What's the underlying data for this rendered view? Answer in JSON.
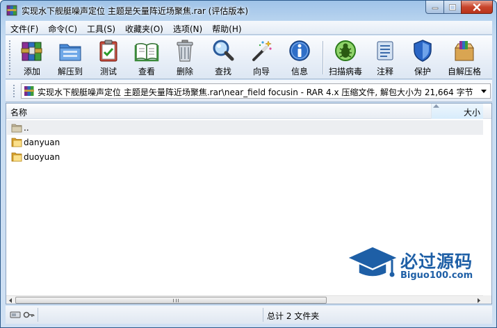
{
  "window": {
    "title": "实现水下舰艇噪声定位 主题是矢量阵近场聚焦.rar (评估版本)"
  },
  "menu": [
    {
      "label": "文件(F)"
    },
    {
      "label": "命令(C)"
    },
    {
      "label": "工具(S)"
    },
    {
      "label": "收藏夹(O)"
    },
    {
      "label": "选项(N)"
    },
    {
      "label": "帮助(H)"
    }
  ],
  "toolbar": {
    "add": "添加",
    "extract": "解压到",
    "test": "测试",
    "view": "查看",
    "delete": "删除",
    "find": "查找",
    "wizard": "向导",
    "info": "信息",
    "virus_scan": "扫描病毒",
    "comment": "注释",
    "protect": "保护",
    "sfx": "自解压格"
  },
  "address": {
    "path": "实现水下舰艇噪声定位 主题是矢量阵近场聚焦.rar\\near_field focusin - RAR 4.x 压缩文件, 解包大小为 21,664 字节"
  },
  "columns": {
    "name": "名称",
    "size": "大小"
  },
  "files": [
    {
      "name": ".."
    },
    {
      "name": "danyuan"
    },
    {
      "name": "duoyuan"
    }
  ],
  "watermark": {
    "title": "必过源码",
    "subtitle": "Biguo100.com"
  },
  "status": {
    "summary": "总计 2 文件夹"
  },
  "colors": {
    "accent": "#1e5fa6",
    "folder": "#e8b84a"
  }
}
